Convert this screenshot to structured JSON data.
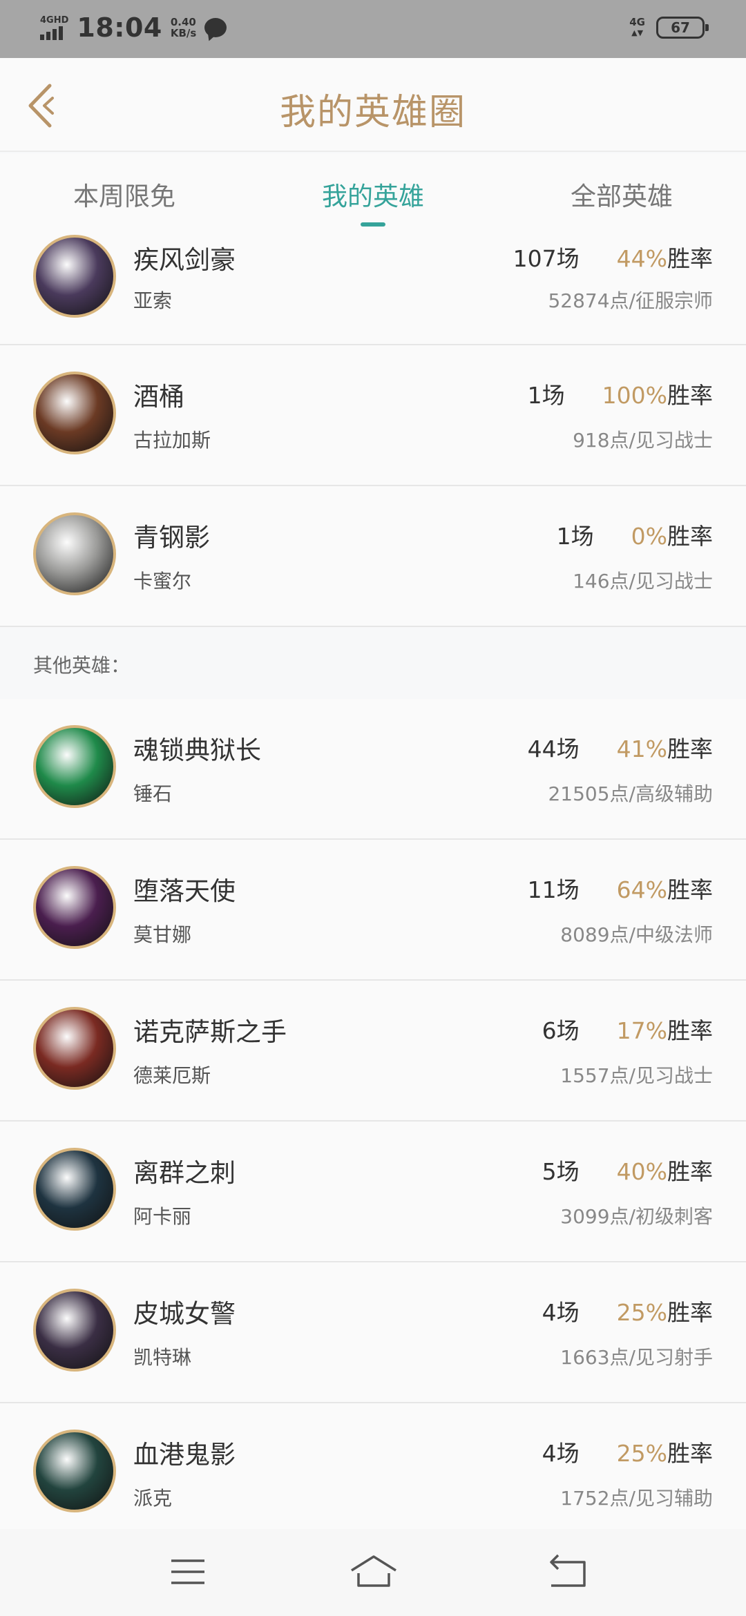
{
  "status_bar": {
    "network": "4GHD",
    "time": "18:04",
    "speed_value": "0.40",
    "speed_unit": "KB/s",
    "net_right": "4G",
    "battery": "67"
  },
  "header": {
    "title": "我的英雄圈"
  },
  "tabs": [
    {
      "label": "本周限免"
    },
    {
      "label": "我的英雄"
    },
    {
      "label": "全部英雄"
    }
  ],
  "active_tab": "我的英雄",
  "my_heroes": [
    {
      "name": "疾风剑豪",
      "sub": "亚索",
      "games": "107场",
      "rate": "44%",
      "rate_label": "胜率",
      "points": "52874点/征服宗师",
      "avatar_color": "#4a3a5c"
    },
    {
      "name": "酒桶",
      "sub": "古拉加斯",
      "games": "1场",
      "rate": "100%",
      "rate_label": "胜率",
      "points": "918点/见习战士",
      "avatar_color": "#6b3a24"
    },
    {
      "name": "青钢影",
      "sub": "卡蜜尔",
      "games": "1场",
      "rate": "0%",
      "rate_label": "胜率",
      "points": "146点/见习战士",
      "avatar_color": "#9a9a98"
    }
  ],
  "section_label": "其他英雄：",
  "other_heroes": [
    {
      "name": "魂锁典狱长",
      "sub": "锤石",
      "games": "44场",
      "rate": "41%",
      "rate_label": "胜率",
      "points": "21505点/高级辅助",
      "avatar_color": "#1f8a4a"
    },
    {
      "name": "堕落天使",
      "sub": "莫甘娜",
      "games": "11场",
      "rate": "64%",
      "rate_label": "胜率",
      "points": "8089点/中级法师",
      "avatar_color": "#4a1e4e"
    },
    {
      "name": "诺克萨斯之手",
      "sub": "德莱厄斯",
      "games": "6场",
      "rate": "17%",
      "rate_label": "胜率",
      "points": "1557点/见习战士",
      "avatar_color": "#7a2a22"
    },
    {
      "name": "离群之刺",
      "sub": "阿卡丽",
      "games": "5场",
      "rate": "40%",
      "rate_label": "胜率",
      "points": "3099点/初级刺客",
      "avatar_color": "#1e3340"
    },
    {
      "name": "皮城女警",
      "sub": "凯特琳",
      "games": "4场",
      "rate": "25%",
      "rate_label": "胜率",
      "points": "1663点/见习射手",
      "avatar_color": "#3a2e44"
    },
    {
      "name": "血港鬼影",
      "sub": "派克",
      "games": "4场",
      "rate": "25%",
      "rate_label": "胜率",
      "points": "1752点/见习辅助",
      "avatar_color": "#22443e"
    }
  ],
  "colors": {
    "accent_gold": "#b89468",
    "tab_active": "#35a39a",
    "rate": "#c19a63"
  },
  "nav": {
    "menu_icon": "menu-icon",
    "home_icon": "home-icon",
    "back_icon": "back-icon"
  }
}
